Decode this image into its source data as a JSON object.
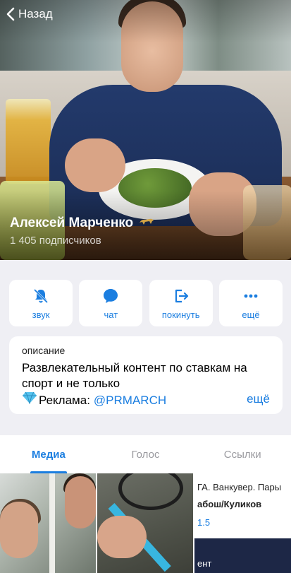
{
  "header": {
    "back_label": "Назад",
    "channel_name": "Алексей Марченко",
    "badge_icon": "leopard-icon",
    "subscribers": "1 405 подписчиков"
  },
  "actions": [
    {
      "label": "звук",
      "icon": "muted-bell-icon"
    },
    {
      "label": "чат",
      "icon": "chat-bubble-icon"
    },
    {
      "label": "покинуть",
      "icon": "leave-icon"
    },
    {
      "label": "ещё",
      "icon": "more-dots-icon"
    }
  ],
  "description": {
    "title": "описание",
    "text": "Развлекательный контент по ставкам на спорт и не только",
    "ad_label": "Реклама:",
    "ad_link": "@PRMARCH",
    "more": "ещё"
  },
  "tabs": [
    {
      "label": "Медиа",
      "active": true
    },
    {
      "label": "Голос",
      "active": false
    },
    {
      "label": "Ссылки",
      "active": false
    }
  ],
  "media": {
    "item3_line1": "ГА. Ванкувер. Пары",
    "item3_line2": "абош/Куликов",
    "item3_line3": "1.5",
    "item3_line4": "ент"
  },
  "colors": {
    "accent": "#1b7ee0",
    "background": "#efeff4"
  }
}
